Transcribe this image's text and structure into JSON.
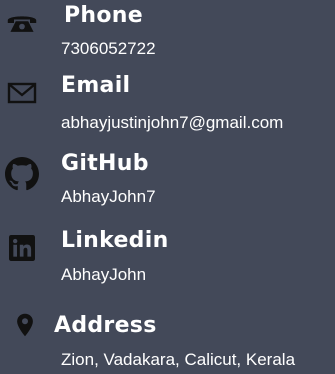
{
  "colors": {
    "background": "#434959",
    "text": "#ffffff",
    "icon": "#111111"
  },
  "contacts": [
    {
      "icon": "phone-icon",
      "label": "Phone",
      "value": "7306052722"
    },
    {
      "icon": "envelope-icon",
      "label": "Email",
      "value": "abhayjustinjohn7@gmail.com"
    },
    {
      "icon": "github-icon",
      "label": "GitHub",
      "value": "AbhayJohn7"
    },
    {
      "icon": "linkedin-icon",
      "label": "Linkedin",
      "value": "AbhayJohn"
    },
    {
      "icon": "location-pin-icon",
      "label": "Address",
      "value": "Zion, Vadakara, Calicut, Kerala"
    }
  ]
}
